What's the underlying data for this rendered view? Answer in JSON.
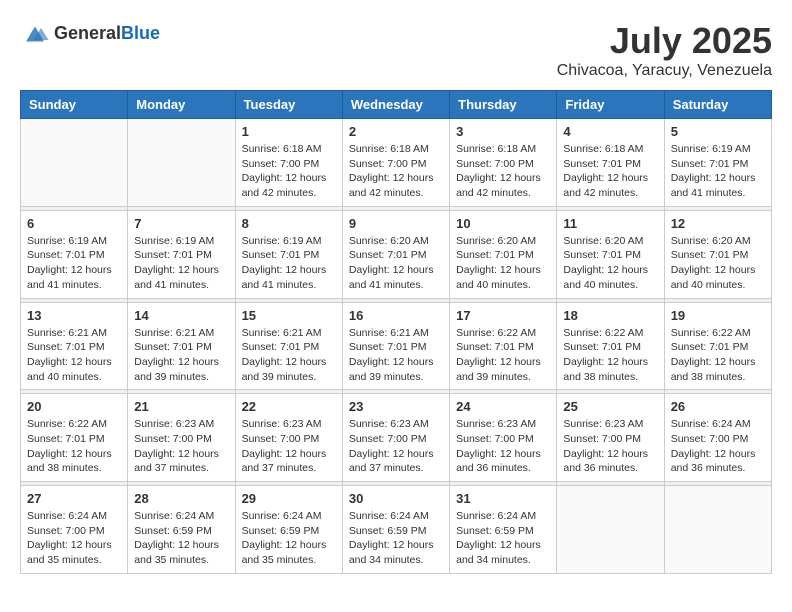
{
  "logo": {
    "general": "General",
    "blue": "Blue"
  },
  "title": "July 2025",
  "subtitle": "Chivacoa, Yaracuy, Venezuela",
  "days_of_week": [
    "Sunday",
    "Monday",
    "Tuesday",
    "Wednesday",
    "Thursday",
    "Friday",
    "Saturday"
  ],
  "weeks": [
    [
      {
        "day": "",
        "info": ""
      },
      {
        "day": "",
        "info": ""
      },
      {
        "day": "1",
        "info": "Sunrise: 6:18 AM\nSunset: 7:00 PM\nDaylight: 12 hours and 42 minutes."
      },
      {
        "day": "2",
        "info": "Sunrise: 6:18 AM\nSunset: 7:00 PM\nDaylight: 12 hours and 42 minutes."
      },
      {
        "day": "3",
        "info": "Sunrise: 6:18 AM\nSunset: 7:00 PM\nDaylight: 12 hours and 42 minutes."
      },
      {
        "day": "4",
        "info": "Sunrise: 6:18 AM\nSunset: 7:01 PM\nDaylight: 12 hours and 42 minutes."
      },
      {
        "day": "5",
        "info": "Sunrise: 6:19 AM\nSunset: 7:01 PM\nDaylight: 12 hours and 41 minutes."
      }
    ],
    [
      {
        "day": "6",
        "info": "Sunrise: 6:19 AM\nSunset: 7:01 PM\nDaylight: 12 hours and 41 minutes."
      },
      {
        "day": "7",
        "info": "Sunrise: 6:19 AM\nSunset: 7:01 PM\nDaylight: 12 hours and 41 minutes."
      },
      {
        "day": "8",
        "info": "Sunrise: 6:19 AM\nSunset: 7:01 PM\nDaylight: 12 hours and 41 minutes."
      },
      {
        "day": "9",
        "info": "Sunrise: 6:20 AM\nSunset: 7:01 PM\nDaylight: 12 hours and 41 minutes."
      },
      {
        "day": "10",
        "info": "Sunrise: 6:20 AM\nSunset: 7:01 PM\nDaylight: 12 hours and 40 minutes."
      },
      {
        "day": "11",
        "info": "Sunrise: 6:20 AM\nSunset: 7:01 PM\nDaylight: 12 hours and 40 minutes."
      },
      {
        "day": "12",
        "info": "Sunrise: 6:20 AM\nSunset: 7:01 PM\nDaylight: 12 hours and 40 minutes."
      }
    ],
    [
      {
        "day": "13",
        "info": "Sunrise: 6:21 AM\nSunset: 7:01 PM\nDaylight: 12 hours and 40 minutes."
      },
      {
        "day": "14",
        "info": "Sunrise: 6:21 AM\nSunset: 7:01 PM\nDaylight: 12 hours and 39 minutes."
      },
      {
        "day": "15",
        "info": "Sunrise: 6:21 AM\nSunset: 7:01 PM\nDaylight: 12 hours and 39 minutes."
      },
      {
        "day": "16",
        "info": "Sunrise: 6:21 AM\nSunset: 7:01 PM\nDaylight: 12 hours and 39 minutes."
      },
      {
        "day": "17",
        "info": "Sunrise: 6:22 AM\nSunset: 7:01 PM\nDaylight: 12 hours and 39 minutes."
      },
      {
        "day": "18",
        "info": "Sunrise: 6:22 AM\nSunset: 7:01 PM\nDaylight: 12 hours and 38 minutes."
      },
      {
        "day": "19",
        "info": "Sunrise: 6:22 AM\nSunset: 7:01 PM\nDaylight: 12 hours and 38 minutes."
      }
    ],
    [
      {
        "day": "20",
        "info": "Sunrise: 6:22 AM\nSunset: 7:01 PM\nDaylight: 12 hours and 38 minutes."
      },
      {
        "day": "21",
        "info": "Sunrise: 6:23 AM\nSunset: 7:00 PM\nDaylight: 12 hours and 37 minutes."
      },
      {
        "day": "22",
        "info": "Sunrise: 6:23 AM\nSunset: 7:00 PM\nDaylight: 12 hours and 37 minutes."
      },
      {
        "day": "23",
        "info": "Sunrise: 6:23 AM\nSunset: 7:00 PM\nDaylight: 12 hours and 37 minutes."
      },
      {
        "day": "24",
        "info": "Sunrise: 6:23 AM\nSunset: 7:00 PM\nDaylight: 12 hours and 36 minutes."
      },
      {
        "day": "25",
        "info": "Sunrise: 6:23 AM\nSunset: 7:00 PM\nDaylight: 12 hours and 36 minutes."
      },
      {
        "day": "26",
        "info": "Sunrise: 6:24 AM\nSunset: 7:00 PM\nDaylight: 12 hours and 36 minutes."
      }
    ],
    [
      {
        "day": "27",
        "info": "Sunrise: 6:24 AM\nSunset: 7:00 PM\nDaylight: 12 hours and 35 minutes."
      },
      {
        "day": "28",
        "info": "Sunrise: 6:24 AM\nSunset: 6:59 PM\nDaylight: 12 hours and 35 minutes."
      },
      {
        "day": "29",
        "info": "Sunrise: 6:24 AM\nSunset: 6:59 PM\nDaylight: 12 hours and 35 minutes."
      },
      {
        "day": "30",
        "info": "Sunrise: 6:24 AM\nSunset: 6:59 PM\nDaylight: 12 hours and 34 minutes."
      },
      {
        "day": "31",
        "info": "Sunrise: 6:24 AM\nSunset: 6:59 PM\nDaylight: 12 hours and 34 minutes."
      },
      {
        "day": "",
        "info": ""
      },
      {
        "day": "",
        "info": ""
      }
    ]
  ]
}
